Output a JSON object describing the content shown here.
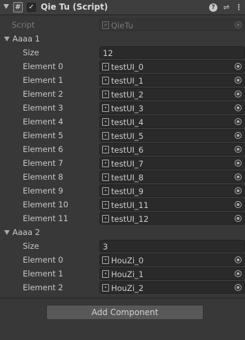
{
  "component": {
    "title": "Qie Tu (Script)",
    "script_icon": "#",
    "enabled_icon": "✓",
    "help_icon": "?",
    "preset_icon": "⇌",
    "more_icon": "⋮"
  },
  "script_field": {
    "label": "Script",
    "value": "QieTu"
  },
  "aaaa1": {
    "label": "Aaaa 1",
    "size_label": "Size",
    "size": "12",
    "elements": [
      {
        "label": "Element 0",
        "value": "testUI_0"
      },
      {
        "label": "Element 1",
        "value": "testUI_1"
      },
      {
        "label": "Element 2",
        "value": "testUI_2"
      },
      {
        "label": "Element 3",
        "value": "testUI_3"
      },
      {
        "label": "Element 4",
        "value": "testUI_4"
      },
      {
        "label": "Element 5",
        "value": "testUI_5"
      },
      {
        "label": "Element 6",
        "value": "testUI_6"
      },
      {
        "label": "Element 7",
        "value": "testUI_7"
      },
      {
        "label": "Element 8",
        "value": "testUI_8"
      },
      {
        "label": "Element 9",
        "value": "testUI_9"
      },
      {
        "label": "Element 10",
        "value": "testUI_11"
      },
      {
        "label": "Element 11",
        "value": "testUI_12"
      }
    ]
  },
  "aaaa2": {
    "label": "Aaaa 2",
    "size_label": "Size",
    "size": "3",
    "elements": [
      {
        "label": "Element 0",
        "value": "HouZi_0"
      },
      {
        "label": "Element 1",
        "value": "HouZi_1"
      },
      {
        "label": "Element 2",
        "value": "HouZi_2"
      }
    ]
  },
  "add_component_label": "Add Component",
  "colors": {
    "background": "#383838",
    "field": "#2a2a2a",
    "button": "#585858"
  }
}
